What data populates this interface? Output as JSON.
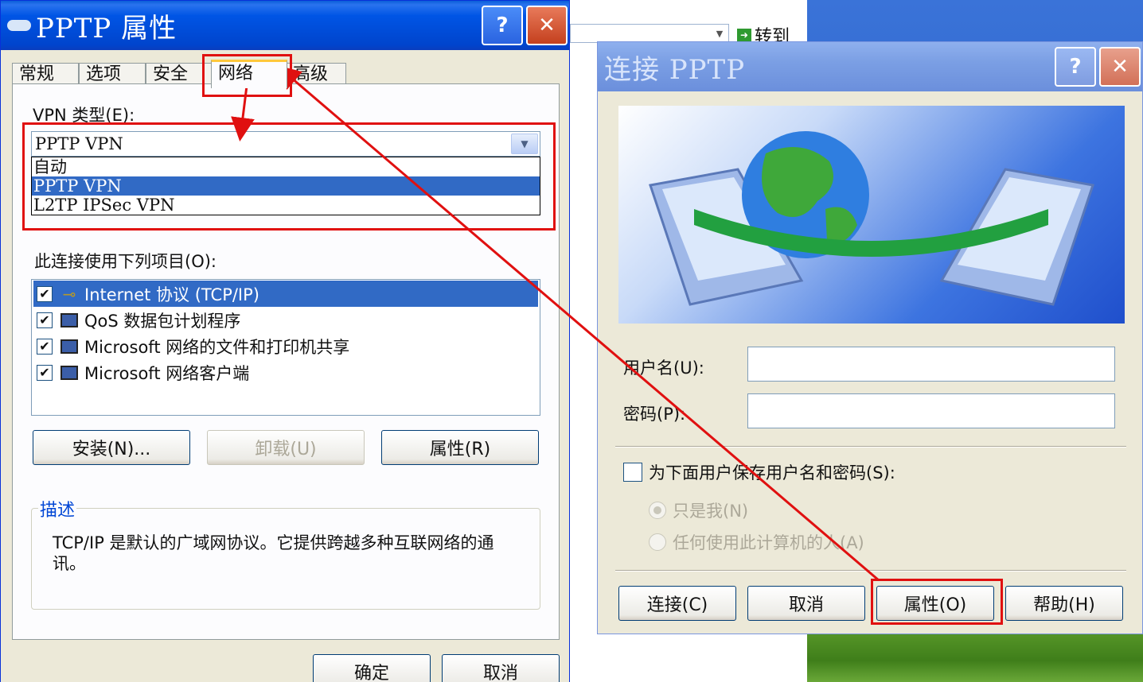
{
  "background": {
    "goto_label": "转到"
  },
  "left_window": {
    "title": "PPTP 属性",
    "help_button": "?",
    "close_button": "✕",
    "tabs": [
      {
        "label": "常规"
      },
      {
        "label": "选项"
      },
      {
        "label": "安全"
      },
      {
        "label": "网络"
      },
      {
        "label": "高级"
      }
    ],
    "vpn_type_label": "VPN 类型(E):",
    "vpn_type_selected": "PPTP VPN",
    "vpn_type_options": [
      "自动",
      "PPTP VPN",
      "L2TP IPSec VPN"
    ],
    "items_label": "此连接使用下列项目(O):",
    "items": [
      {
        "label": "Internet 协议 (TCP/IP)",
        "checked": true,
        "icon": "network-protocol-icon"
      },
      {
        "label": "QoS 数据包计划程序",
        "checked": true,
        "icon": "computer-icon"
      },
      {
        "label": "Microsoft 网络的文件和打印机共享",
        "checked": true,
        "icon": "computer-icon"
      },
      {
        "label": "Microsoft 网络客户端",
        "checked": true,
        "icon": "computer-icon"
      }
    ],
    "install_button": "安装(N)...",
    "uninstall_button": "卸载(U)",
    "properties_button": "属性(R)",
    "description_title": "描述",
    "description_text": "TCP/IP 是默认的广域网协议。它提供跨越多种互联网络的通讯。",
    "ok_button": "确定",
    "cancel_button": "取消"
  },
  "right_window": {
    "title": "连接 PPTP",
    "help_button": "?",
    "close_button": "✕",
    "username_label": "用户名(U):",
    "username_value": "",
    "password_label": "密码(P):",
    "password_value": "",
    "save_label": "为下面用户保存用户名和密码(S):",
    "radio_me": "只是我(N)",
    "radio_anyone": "任何使用此计算机的人(A)",
    "connect_button": "连接(C)",
    "cancel_button": "取消",
    "properties_button": "属性(O)",
    "help_button_label": "帮助(H)"
  },
  "colors": {
    "annotation": "#e01010",
    "selection": "#316ac5",
    "titlebar_active": "#0055e5",
    "titlebar_inactive": "#7b9fe4"
  }
}
